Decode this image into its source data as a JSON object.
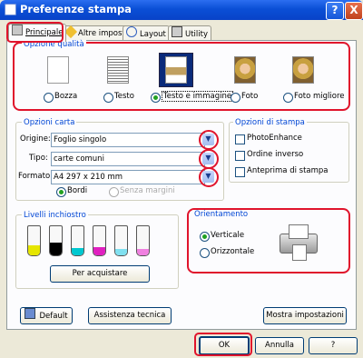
{
  "window": {
    "title": "Preferenze stampa",
    "help_label": "?",
    "close_label": "X"
  },
  "tabs": [
    {
      "label": "Principale",
      "active": true
    },
    {
      "label": "Altre impost."
    },
    {
      "label": "Layout"
    },
    {
      "label": "Utility"
    }
  ],
  "quality": {
    "title": "Opzione qualità",
    "options": [
      {
        "label": "Bozza",
        "selected": false
      },
      {
        "label": "Testo",
        "selected": false
      },
      {
        "label": "Testo e immagine",
        "selected": true
      },
      {
        "label": "Foto",
        "selected": false
      },
      {
        "label": "Foto migliore",
        "selected": false
      }
    ]
  },
  "paper": {
    "title": "Opzioni carta",
    "source_label": "Origine:",
    "source_value": "Foglio singolo",
    "type_label": "Tipo:",
    "type_value": "carte comuni",
    "format_label": "Formato:",
    "format_value": "A4 297 x 210 mm",
    "borders_label": "Bordi",
    "borderless_label": "Senza margini"
  },
  "print_options": {
    "title": "Opzioni di stampa",
    "photo_enhance": "PhotoEnhance",
    "reverse_order": "Ordine inverso",
    "preview": "Anteprima di stampa"
  },
  "ink": {
    "title": "Livelli inchiostro",
    "levels": [
      {
        "color": "#e6e600",
        "level": 0.35
      },
      {
        "color": "#000000",
        "level": 0.45
      },
      {
        "color": "#00c8d0",
        "level": 0.25
      },
      {
        "color": "#e020c0",
        "level": 0.28
      },
      {
        "color": "#80e0f0",
        "level": 0.22
      },
      {
        "color": "#f080e0",
        "level": 0.22
      }
    ],
    "buy_button": "Per acquistare"
  },
  "orientation": {
    "title": "Orientamento",
    "portrait": "Verticale",
    "landscape": "Orizzontale"
  },
  "bottom": {
    "default_button": "Default",
    "support_button": "Assistenza tecnica",
    "show_settings_button": "Mostra impostazioni"
  },
  "footer": {
    "ok": "OK",
    "cancel": "Annulla",
    "help": "?"
  },
  "colors": {
    "accent": "#0046d5",
    "highlight": "#e0142c"
  }
}
